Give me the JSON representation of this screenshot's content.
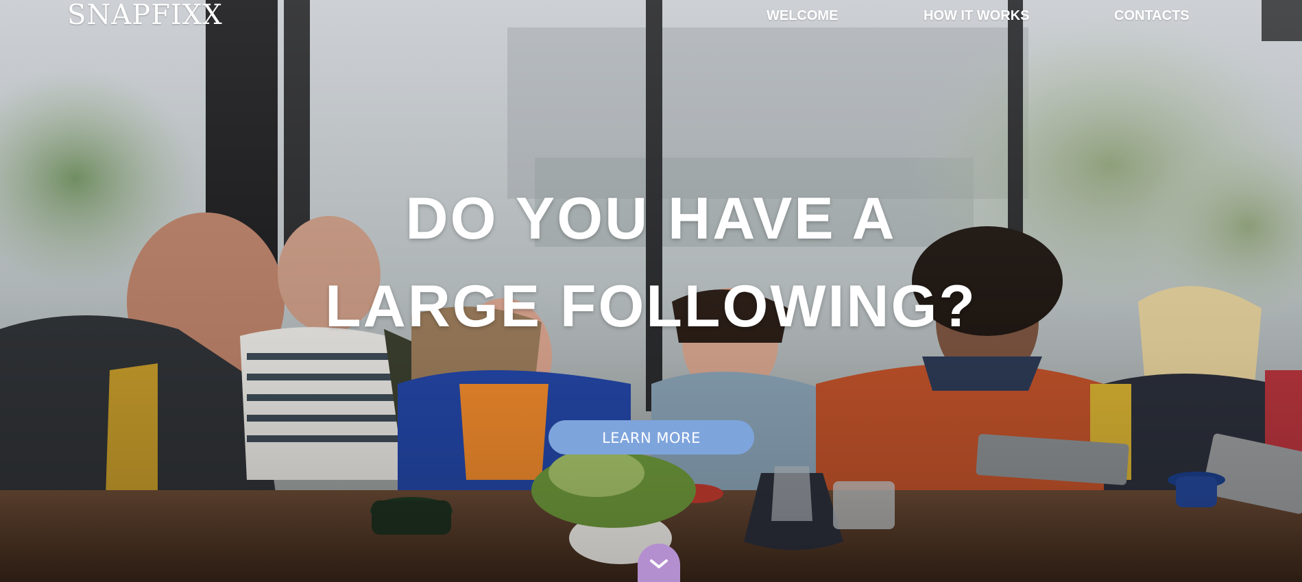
{
  "brand": {
    "logo_text": "SNAPFIXX"
  },
  "nav": {
    "items": [
      {
        "label": "WELCOME"
      },
      {
        "label": "HOW IT WORKS"
      },
      {
        "label": "CONTACTS"
      }
    ]
  },
  "hero": {
    "headline_line1": "DO YOU HAVE A",
    "headline_line2": "LARGE FOLLOWING?",
    "cta_label": "LEARN MORE",
    "scroll_icon": "chevron-down-icon"
  },
  "colors": {
    "cta_background": "#7ea4dc",
    "scroll_tab_background": "#b48fd0",
    "text": "#ffffff"
  }
}
